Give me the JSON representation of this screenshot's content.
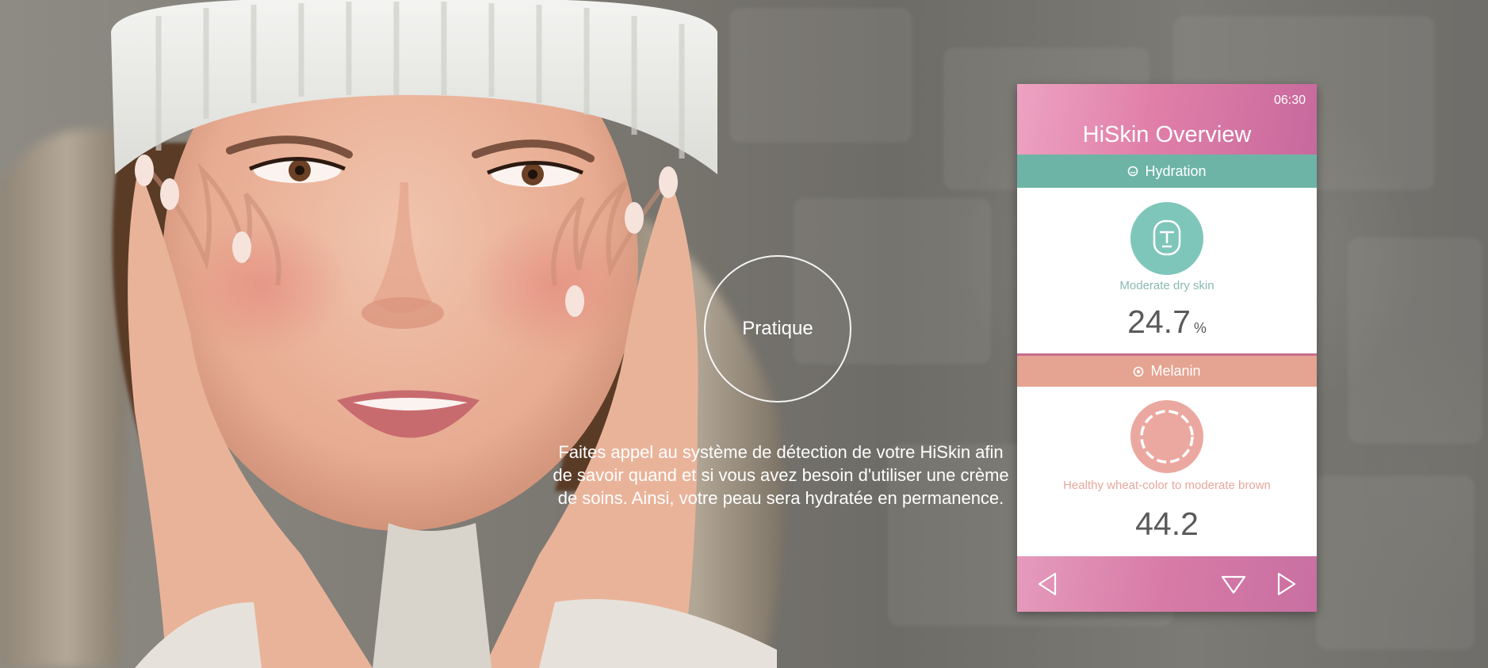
{
  "overlay": {
    "circle_label": "Pratique",
    "description": "Faites appel au système de détection de votre HiSkin afin de savoir quand et si vous avez besoin d'utiliser une crème de soins. Ainsi, votre peau sera hydratée en permanence."
  },
  "phone": {
    "time": "06:30",
    "title": "HiSkin Overview",
    "hydration": {
      "band_label": "Hydration",
      "status": "Moderate dry skin",
      "value": "24.7",
      "unit": "%"
    },
    "melanin": {
      "band_label": "Melanin",
      "status": "Healthy wheat-color to moderate brown",
      "value": "44.2"
    }
  },
  "colors": {
    "hydration_band": "#6db4a7",
    "melanin_band": "#e5a391",
    "header_pink": "#e07fa8"
  }
}
